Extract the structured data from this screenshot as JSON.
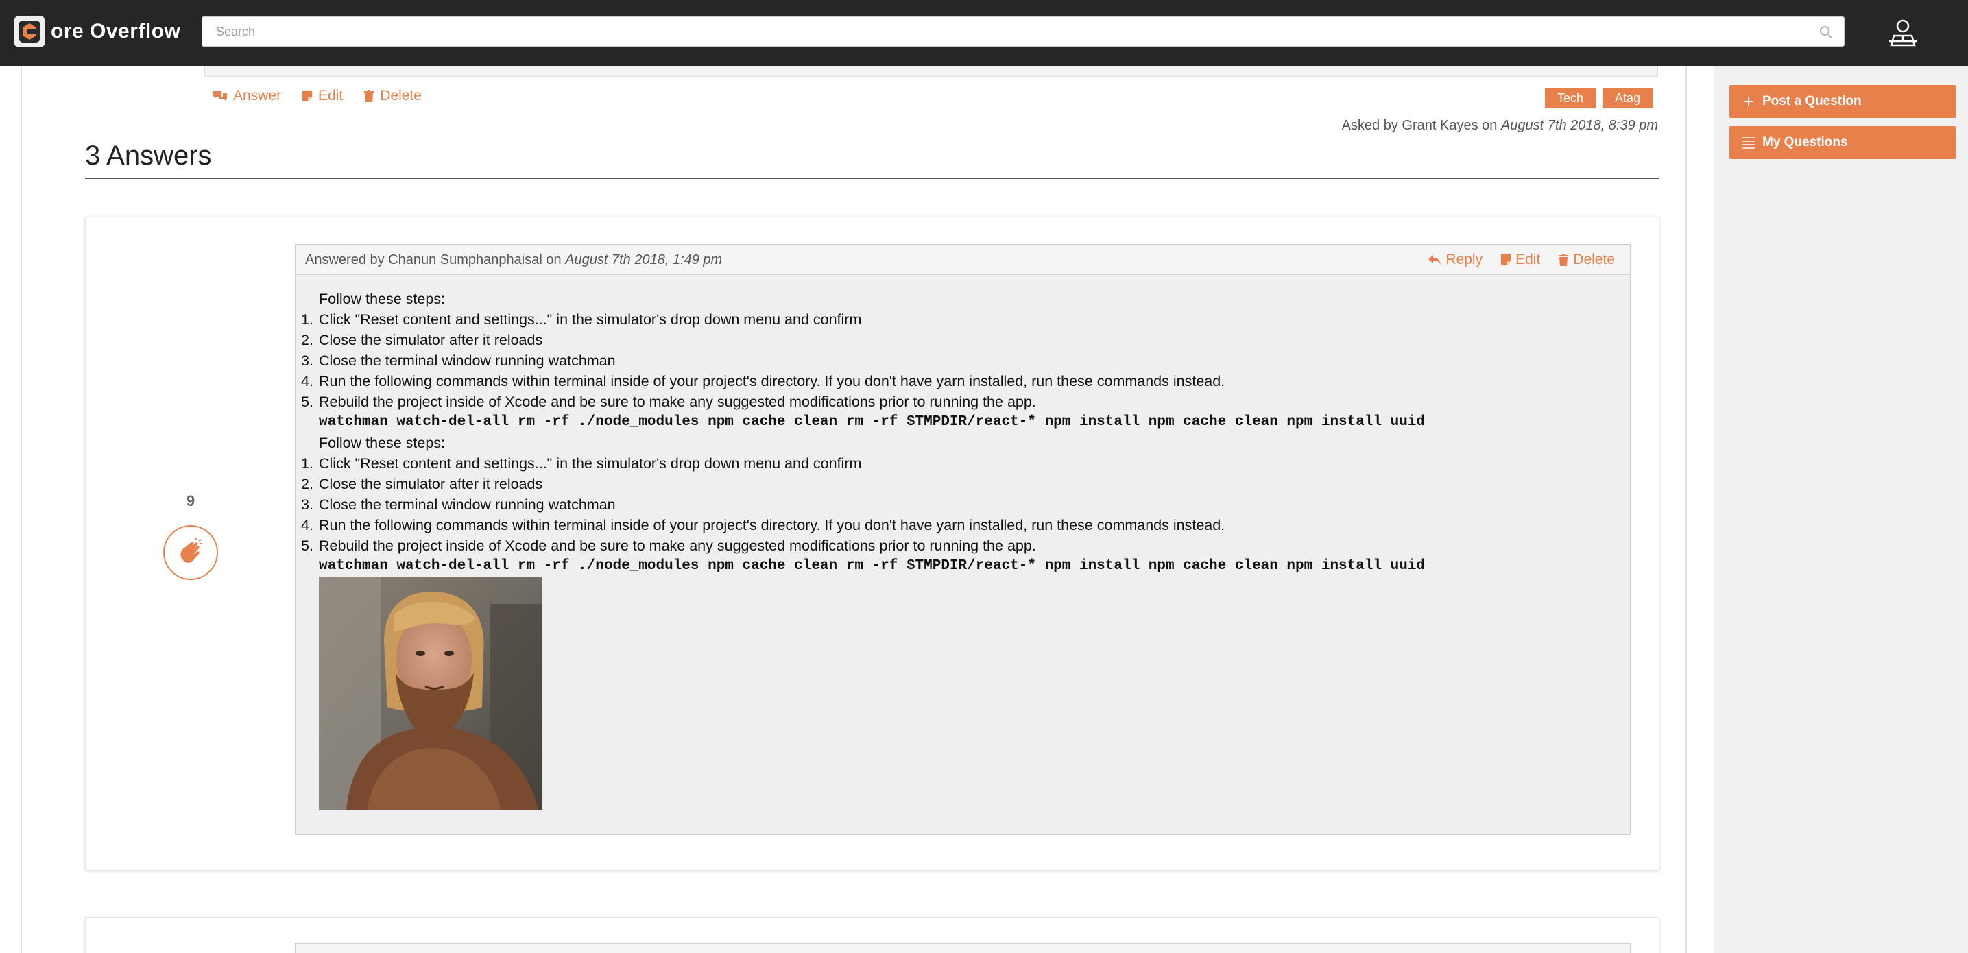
{
  "brand": {
    "logo_letter": "C",
    "name": "ore Overflow"
  },
  "search": {
    "placeholder": "Search"
  },
  "question": {
    "actions": {
      "answer": "Answer",
      "edit": "Edit",
      "delete": "Delete"
    },
    "tags": [
      "Tech",
      "Atag"
    ],
    "asked": {
      "prefix": "Asked by Grant Kayes on",
      "date": "August 7th 2018, 8:39 pm"
    }
  },
  "answers": {
    "heading": "3 Answers",
    "items": [
      {
        "votes": "9",
        "meta": {
          "prefix": "Answered by Chanun Sumphanphaisal on",
          "date": "August 7th 2018, 1:49 pm"
        },
        "actions": {
          "reply": "Reply",
          "edit": "Edit",
          "delete": "Delete"
        },
        "intro": "Follow these steps:",
        "steps": [
          {
            "num": "1.",
            "text": "Click \"Reset content and settings...\" in the simulator's drop down menu and confirm"
          },
          {
            "num": "2.",
            "text": "Close the simulator after it reloads"
          },
          {
            "num": "3.",
            "text": "Close the terminal window running watchman"
          },
          {
            "num": "4.",
            "text": "Run the following commands within terminal inside of your project's directory. If you don't have yarn installed, run these commands instead."
          },
          {
            "num": "5.",
            "text": "Rebuild the project inside of Xcode and be sure to make any suggested modifications prior to running the app."
          }
        ],
        "code": "watchman watch-del-all rm -rf ./node_modules npm cache clean rm -rf $TMPDIR/react-* npm install npm cache clean npm install uuid"
      }
    ]
  },
  "sidebar": {
    "post_question": "Post a Question",
    "my_questions": "My Questions"
  },
  "colors": {
    "accent": "#e8804c",
    "topbar": "#262626",
    "sidebar": "#f1f1f1"
  }
}
